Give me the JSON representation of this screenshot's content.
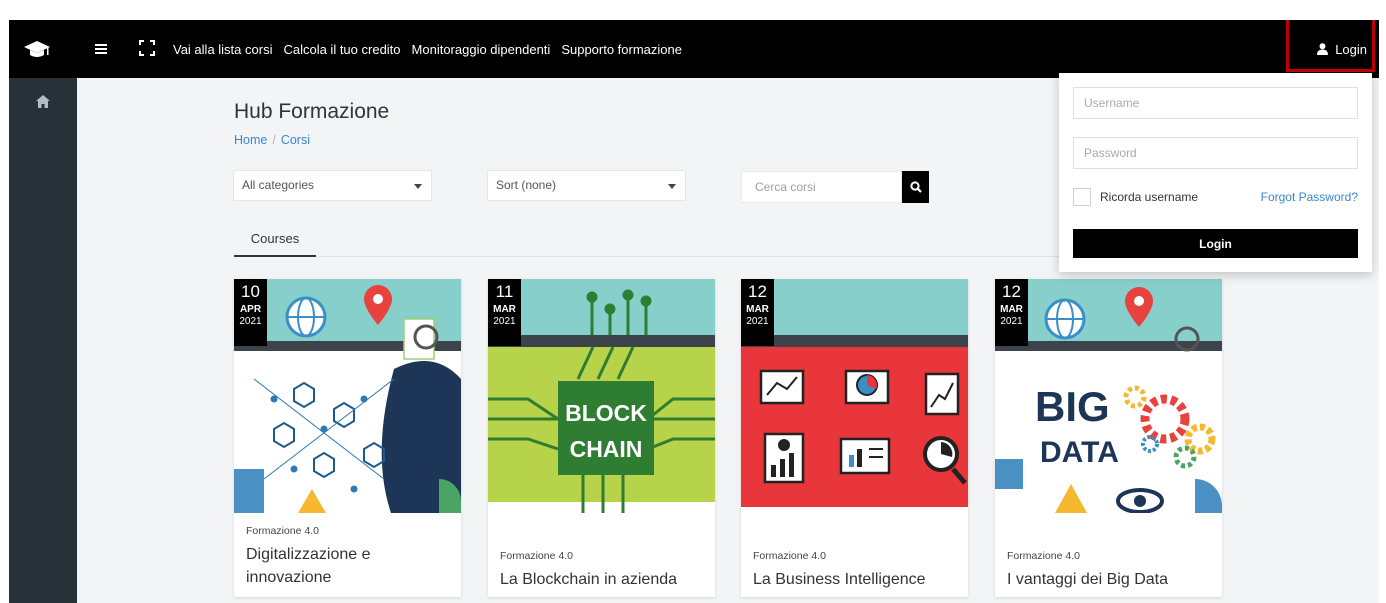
{
  "navbar": {
    "logo_icon": "graduation-cap-icon",
    "menu_icon": "hamburger-menu-icon",
    "fullscreen_icon": "fullscreen-icon",
    "links": [
      "Vai alla lista corsi",
      "Calcola il tuo credito",
      "Monitoraggio dipendenti",
      "Supporto formazione"
    ],
    "login_label": "Login",
    "login_icon": "user-icon"
  },
  "sidebar": {
    "home_icon": "home-icon"
  },
  "main": {
    "title": "Hub Formazione",
    "breadcrumb": [
      "Home",
      "Corsi"
    ],
    "breadcrumb_sep": "/",
    "category_select": "All categories",
    "sort_select": "Sort (none)",
    "search_placeholder": "Cerca corsi",
    "search_icon": "search-icon",
    "tab": "Courses"
  },
  "courses": [
    {
      "day": "10",
      "month": "APR",
      "year": "2021",
      "category": "Formazione 4.0",
      "title": "Digitalizzazione e innovazione",
      "image": "digital-network-illustration"
    },
    {
      "day": "11",
      "month": "MAR",
      "year": "2021",
      "category": "Formazione 4.0",
      "title": "La Blockchain in azienda",
      "image": "blockchain-circuit-illustration"
    },
    {
      "day": "12",
      "month": "MAR",
      "year": "2021",
      "category": "Formazione 4.0",
      "title": "La Business Intelligence",
      "image": "business-charts-illustration"
    },
    {
      "day": "12",
      "month": "MAR",
      "year": "2021",
      "category": "Formazione 4.0",
      "title": "I vantaggi dei Big Data",
      "image": "big-data-gears-illustration"
    }
  ],
  "login_panel": {
    "username_placeholder": "Username",
    "password_placeholder": "Password",
    "remember_label": "Ricorda username",
    "forgot_label": "Forgot Password?",
    "button_label": "Login"
  },
  "colors": {
    "navbar": "#000000",
    "sidebar": "#263238",
    "link": "#3b86d1",
    "highlight": "#c00000"
  }
}
